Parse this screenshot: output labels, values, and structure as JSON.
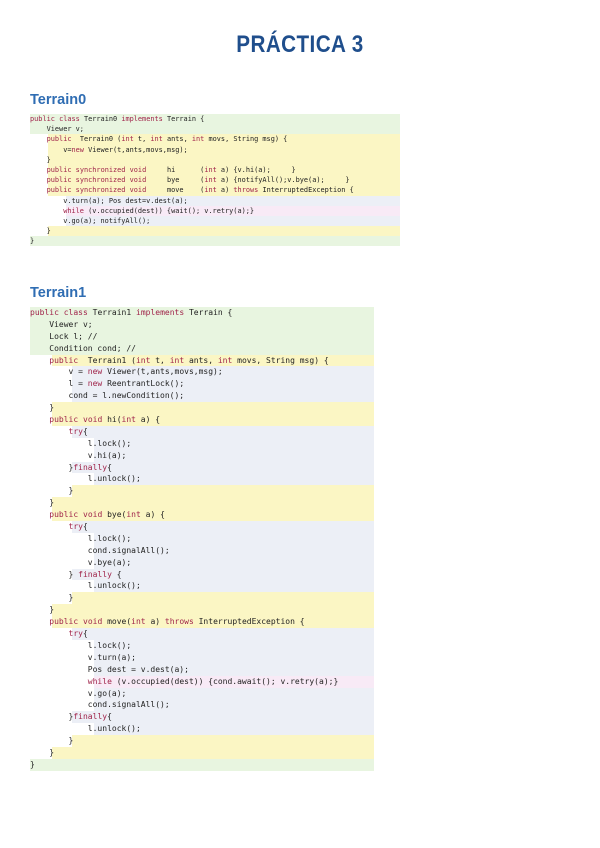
{
  "title": "PRÁCTICA 3",
  "sections": [
    {
      "heading": "Terrain0",
      "lines": [
        "public class Terrain0 implements Terrain {",
        "    Viewer v;",
        "    public  Terrain0 (int t, int ants, int movs, String msg) {",
        "        v=new Viewer(t,ants,movs,msg);",
        "    }",
        "    public synchronized void     hi      (int a) {v.hi(a);     }",
        "    public synchronized void     bye     (int a) {notifyAll();v.bye(a);     }",
        "    public synchronized void     move    (int a) throws InterruptedException {",
        "        v.turn(a); Pos dest=v.dest(a);",
        "        while (v.occupied(dest)) {wait(); v.retry(a);}",
        "        v.go(a); notifyAll();",
        "    }",
        "}"
      ]
    },
    {
      "heading": "Terrain1",
      "lines": [
        "public class Terrain1 implements Terrain {",
        "    Viewer v;",
        "    Lock l; //",
        "    Condition cond; //",
        "    public  Terrain1 (int t, int ants, int movs, String msg) {",
        "        v = new Viewer(t,ants,movs,msg);",
        "        l = new ReentrantLock();",
        "        cond = l.newCondition();",
        "    }",
        "    public void hi(int a) {",
        "        try{",
        "            l.lock();",
        "            v.hi(a);",
        "        }finally{",
        "            l.unlock();",
        "        }",
        "    }",
        "    public void bye(int a) {",
        "        try{",
        "            l.lock();",
        "            cond.signalAll();",
        "            v.bye(a);",
        "        } finally {",
        "            l.unlock();",
        "        }",
        "    }",
        "    public void move(int a) throws InterruptedException {",
        "        try{",
        "            l.lock();",
        "            v.turn(a);",
        "            Pos dest = v.dest(a);",
        "            while (v.occupied(dest)) {cond.await(); v.retry(a);}",
        "            v.go(a);",
        "            cond.signalAll();",
        "        }finally{",
        "            l.unlock();",
        "        }",
        "    }",
        "}"
      ]
    }
  ]
}
